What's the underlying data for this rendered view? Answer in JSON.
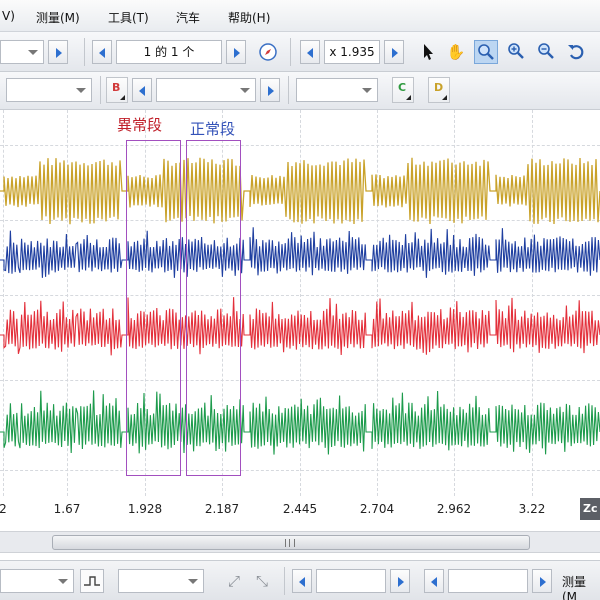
{
  "menubar": {
    "items": [
      {
        "label": "V)"
      },
      {
        "label": "测量(M)"
      },
      {
        "label": "工具(T)"
      },
      {
        "label": "汽车"
      },
      {
        "label": "帮助(H)"
      }
    ]
  },
  "toolbar": {
    "page_indicator": "1 的 1 个",
    "zoom_factor": "x 1.935",
    "channel_buttons": [
      "B",
      "C",
      "D"
    ]
  },
  "annotations": {
    "abnormal_label": "異常段",
    "normal_label": "正常段",
    "abnormal_color": "#c0202a",
    "normal_color": "#3352b8",
    "box_color": "#a24fbf"
  },
  "traces": {
    "colors": [
      "#c9a22a",
      "#1f3fa0",
      "#e3303b",
      "#1d9b4c"
    ]
  },
  "time_axis": {
    "ticks": [
      "2",
      "1.67",
      "1.928",
      "2.187",
      "2.445",
      "2.704",
      "2.962",
      "3.22"
    ],
    "corner_label": "Zc"
  },
  "bottombar": {
    "measure_label": "测量(M"
  }
}
